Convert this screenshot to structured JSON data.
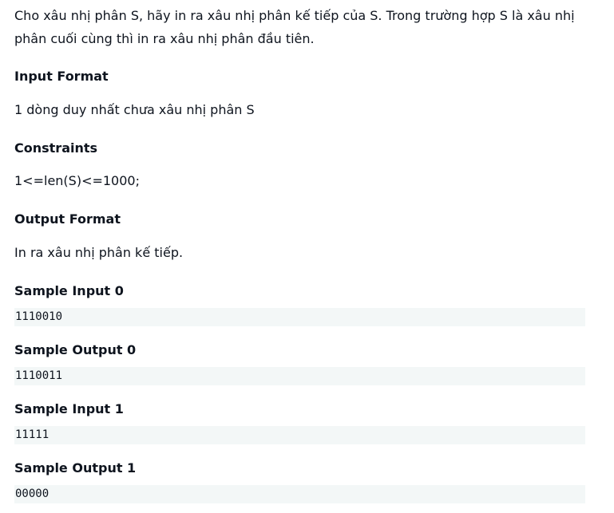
{
  "problem": {
    "statement": "Cho xâu nhị phân S, hãy in ra xâu nhị phân kế tiếp của S. Trong trường hợp S là xâu nhị phân cuối cùng thì in ra xâu nhị phân đầu tiên."
  },
  "input_format": {
    "heading": "Input Format",
    "text": "1 dòng duy nhất chưa xâu nhị phân S"
  },
  "constraints": {
    "heading": "Constraints",
    "text": "1<=len(S)<=1000;"
  },
  "output_format": {
    "heading": "Output Format",
    "text": "In ra xâu nhị phân kế tiếp."
  },
  "samples": [
    {
      "heading": "Sample Input 0",
      "value": "1110010"
    },
    {
      "heading": "Sample Output 0",
      "value": "1110011"
    },
    {
      "heading": "Sample Input 1",
      "value": "11111"
    },
    {
      "heading": "Sample Output 1",
      "value": "00000"
    }
  ]
}
